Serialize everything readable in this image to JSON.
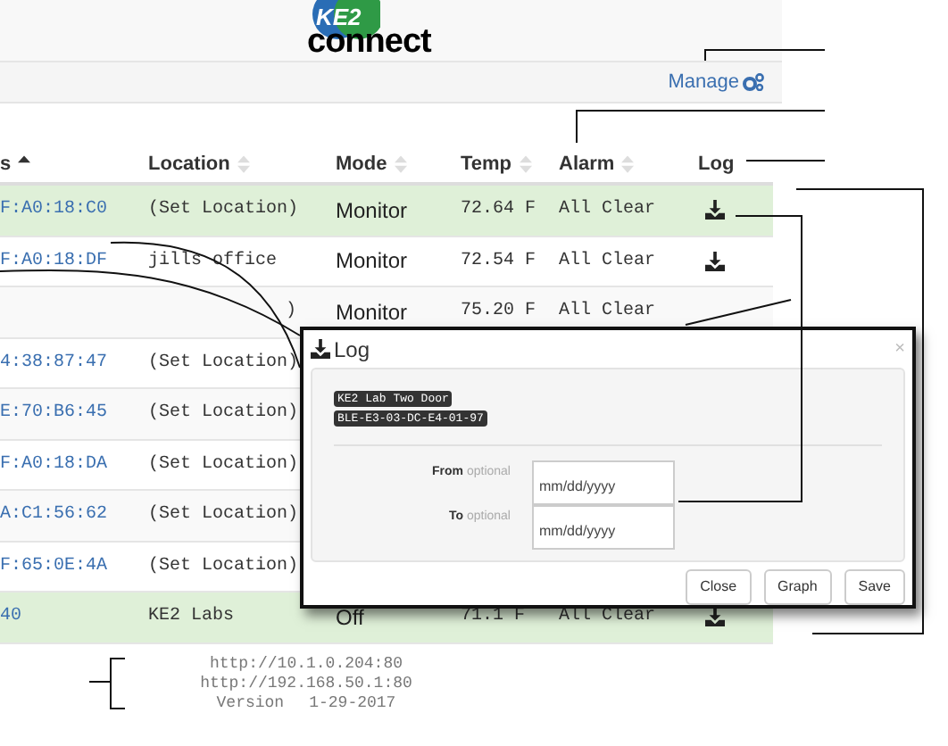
{
  "logo": {
    "mark": "KE2",
    "wordmark": "connect"
  },
  "nav": {
    "manage": "Manage"
  },
  "table": {
    "columns": [
      {
        "label": "s",
        "sorted": true
      },
      {
        "label": "Location",
        "sorted": false
      },
      {
        "label": "Mode",
        "sorted": false
      },
      {
        "label": "Temp",
        "sorted": false
      },
      {
        "label": "Alarm",
        "sorted": false
      },
      {
        "label": "Log"
      }
    ],
    "rows": [
      {
        "highlighted": true,
        "address": "F:A0:18:C0",
        "location": "(Set Location)",
        "mode": "Monitor",
        "temp": "72.64 F",
        "alarm": "All Clear",
        "log": true
      },
      {
        "highlighted": false,
        "address": "F:A0:18:DF",
        "location": "jills office",
        "mode": "Monitor",
        "temp": "72.54 F",
        "alarm": "All Clear",
        "log": true
      },
      {
        "highlighted": false,
        "location": ")",
        "mode": "Monitor",
        "temp": "75.20 F",
        "alarm": "All Clear"
      },
      {
        "highlighted": false,
        "address": "4:38:87:47",
        "location": "(Set Location)"
      },
      {
        "highlighted": false,
        "address": "E:70:B6:45",
        "location": "(Set Location)"
      },
      {
        "highlighted": false,
        "address": "F:A0:18:DA",
        "location": "(Set Location)"
      },
      {
        "highlighted": false,
        "address": "A:C1:56:62",
        "location": "(Set Location)"
      },
      {
        "highlighted": false,
        "address": "F:65:0E:4A",
        "location": "(Set Location)"
      },
      {
        "highlighted": true,
        "address": "40",
        "location": "KE2 Labs",
        "mode": "Off",
        "temp": "71.1 F",
        "alarm": "All Clear",
        "log": true
      }
    ]
  },
  "modal": {
    "title": "Log",
    "close": "×",
    "tags": [
      "KE2 Lab Two Door",
      "BLE-E3-03-DC-E4-01-97"
    ],
    "fields": [
      {
        "label": "From",
        "hint": "optional",
        "placeholder": "mm/dd/yyyy"
      },
      {
        "label": "To",
        "hint": "optional",
        "placeholder": "mm/dd/yyyy"
      }
    ],
    "buttons": [
      "Close",
      "Graph",
      "Save"
    ]
  },
  "footer": {
    "urls": [
      "http://10.1.0.204:80",
      "http://192.168.50.1:80"
    ],
    "version_label": "Version",
    "version": "1-29-2017"
  }
}
